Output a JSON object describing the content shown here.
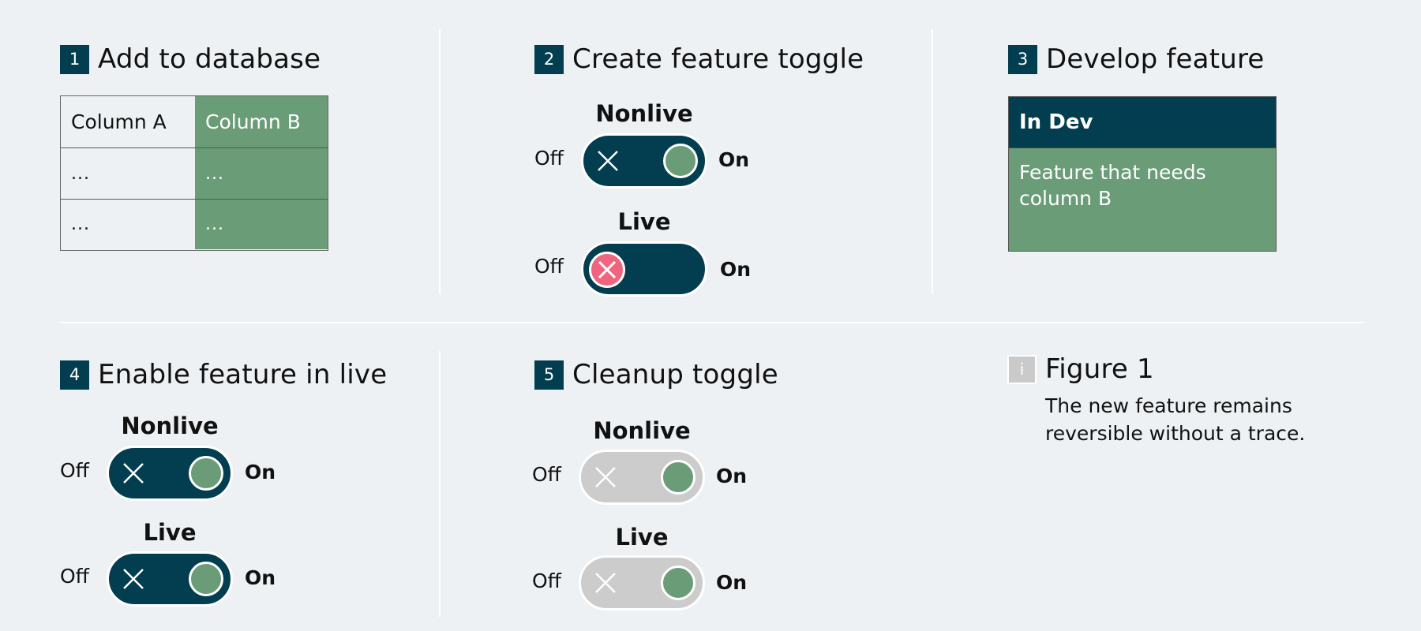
{
  "colors": {
    "background": "#edf1f4",
    "dark_teal": "#023e4f",
    "green": "#6b9c78",
    "grey_switch": "#cccccc",
    "error_pink": "#f0647e",
    "divider": "#ffffff"
  },
  "steps": [
    {
      "number": "1",
      "title": "Add to database"
    },
    {
      "number": "2",
      "title": "Create feature toggle"
    },
    {
      "number": "3",
      "title": "Develop feature"
    },
    {
      "number": "4",
      "title": "Enable feature in live"
    },
    {
      "number": "5",
      "title": "Cleanup toggle"
    }
  ],
  "db_table": {
    "headers": [
      "Column A",
      "Column B"
    ],
    "rows": [
      [
        "...",
        "..."
      ],
      [
        "...",
        "..."
      ]
    ]
  },
  "dev_card": {
    "header": "In Dev",
    "body": "Feature that needs column B"
  },
  "toggle_labels": {
    "off": "Off",
    "on": "On"
  },
  "toggles": {
    "step2": [
      {
        "env": "Nonlive",
        "state": "on",
        "style": "active"
      },
      {
        "env": "Live",
        "state": "off",
        "style": "active"
      }
    ],
    "step4": [
      {
        "env": "Nonlive",
        "state": "on",
        "style": "active"
      },
      {
        "env": "Live",
        "state": "on",
        "style": "active"
      }
    ],
    "step5": [
      {
        "env": "Nonlive",
        "state": "on",
        "style": "disabled"
      },
      {
        "env": "Live",
        "state": "on",
        "style": "disabled"
      }
    ]
  },
  "figure": {
    "icon": "i",
    "title": "Figure 1",
    "caption_line1": "The new feature remains",
    "caption_line2": "reversible without a trace."
  }
}
